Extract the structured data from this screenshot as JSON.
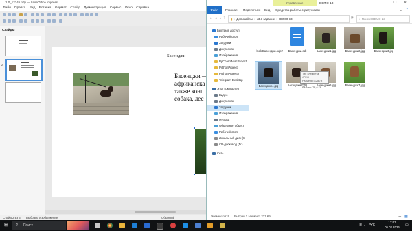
{
  "impress": {
    "title": "1.0_12345.odp — LibreOffice Impress",
    "menu": [
      "Файл",
      "Правка",
      "Вид",
      "Вставка",
      "Формат",
      "Слайд",
      "Демонстрация",
      "Сервис",
      "Окно",
      "Справка"
    ],
    "slides_header": "Слайды",
    "slide_number": "2",
    "slide_title": "Басенджи",
    "slide_body_lines": [
      "Басенджи —",
      "африканска",
      "также конг",
      "собака, лес"
    ],
    "status_left": "Слайд 2 из 3",
    "status_mid": "Выбрано Изображение",
    "status_right": "Обычный"
  },
  "explorer": {
    "title": "DEMO-13",
    "manage_tab": "Управление",
    "tabs": [
      "Файл",
      "Главная",
      "Поделиться",
      "Вид",
      "Средства работы с рисунками"
    ],
    "path": [
      "Доп.файлы",
      "13.1 задание",
      "DEMO-13"
    ],
    "search_placeholder": "Поиск: DEMO-13",
    "nav": [
      {
        "label": "Быстрый доступ",
        "color": "#2b78d0"
      },
      {
        "label": "Рабочий стол",
        "color": "#3a8ee0"
      },
      {
        "label": "Загрузки",
        "color": "#2b78d0"
      },
      {
        "label": "Документы",
        "color": "#6b7a8a"
      },
      {
        "label": "Изображения",
        "color": "#4aa0d8"
      },
      {
        "label": "PyCharmMiscProject",
        "color": "#e6b93c"
      },
      {
        "label": "PythonProject",
        "color": "#e6b93c"
      },
      {
        "label": "PythonProject2",
        "color": "#e6b93c"
      },
      {
        "label": "Telegram Desktop",
        "color": "#e6b93c"
      },
      {
        "label": "Этот компьютер",
        "color": "#3a6ea5"
      },
      {
        "label": "Видео",
        "color": "#6b7a8a"
      },
      {
        "label": "Документы",
        "color": "#6b7a8a"
      },
      {
        "label": "Загрузки",
        "color": "#2b78d0"
      },
      {
        "label": "Изображения",
        "color": "#4aa0d8"
      },
      {
        "label": "Музыка",
        "color": "#6b7a8a"
      },
      {
        "label": "Объемные объект",
        "color": "#4aa0d8"
      },
      {
        "label": "Рабочий стол",
        "color": "#3a8ee0"
      },
      {
        "label": "Локальный диск (C",
        "color": "#8a8a8a"
      },
      {
        "label": "CD-дисковод (D:)",
        "color": "#8a8a8a"
      },
      {
        "label": "Сеть",
        "color": "#3a6ea5"
      }
    ],
    "files": [
      {
        "name": "~lock.Басенджи.odp#",
        "kind": "blank"
      },
      {
        "name": "Басенджи.odt",
        "kind": "doc"
      },
      {
        "name": "Басенджи1.jpg",
        "kind": "photo1"
      },
      {
        "name": "Басенджи2.jpg",
        "kind": "photo2"
      },
      {
        "name": "Басенджи3.jpg",
        "kind": "photo3"
      },
      {
        "name": "Басенджи4.jpg",
        "kind": "photo4"
      },
      {
        "name": "Басенджи5.jpg",
        "kind": "photo5"
      },
      {
        "name": "Басенджи6.jpg",
        "kind": "photo6"
      },
      {
        "name": "Басенджи7.jpg",
        "kind": "photo7"
      }
    ],
    "tooltip_lines": [
      "Тип элемента: JPEG",
      "Размеры: 1280 x 853",
      "Размер: 78,6 КБ"
    ],
    "status_count": "Элементов: 9",
    "status_selected": "Выбран 1 элемент: 237 КБ"
  },
  "taskbar": {
    "search_placeholder": "Поиск",
    "time": "17:07",
    "date": "05.02.2026",
    "lang": "РУС"
  },
  "colors": {
    "manage_tab": "#e9f09a",
    "file_tab": "#1f6fc8",
    "taskbar": "#101214",
    "selection": "#cce4f7"
  }
}
